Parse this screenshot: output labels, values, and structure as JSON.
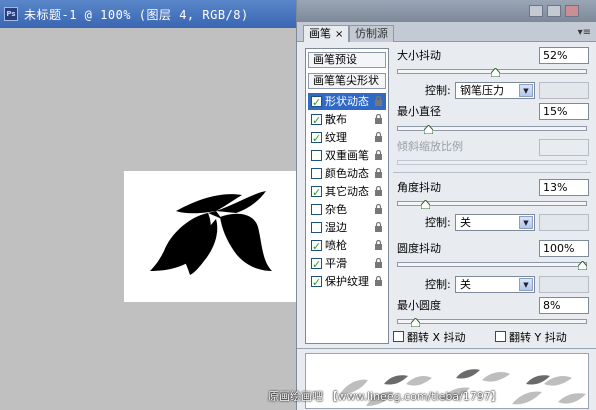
{
  "colors": {
    "accent": "#316ac5",
    "check": "#21a121",
    "titlebar": "#3a66b3"
  },
  "document": {
    "title": "未标题-1 @ 100% (图层 4, RGB/8)",
    "app_icon_label": "Ps"
  },
  "panel": {
    "tabs": [
      {
        "label": "画笔",
        "close": "×"
      },
      {
        "label": "仿制源"
      }
    ],
    "menu_icon": "▾≡"
  },
  "brush_list": {
    "presets_label": "画笔预设",
    "tip_shape_label": "画笔笔尖形状",
    "items": [
      {
        "label": "形状动态",
        "checked": true,
        "selected": true
      },
      {
        "label": "散布",
        "checked": true
      },
      {
        "label": "纹理",
        "checked": true
      },
      {
        "label": "双重画笔",
        "checked": false
      },
      {
        "label": "颜色动态",
        "checked": false
      },
      {
        "label": "其它动态",
        "checked": true
      },
      {
        "label": "杂色",
        "checked": false
      },
      {
        "label": "湿边",
        "checked": false
      },
      {
        "label": "喷枪",
        "checked": true
      },
      {
        "label": "平滑",
        "checked": true
      },
      {
        "label": "保护纹理",
        "checked": true
      }
    ]
  },
  "settings": {
    "size_jitter": {
      "label": "大小抖动",
      "value": "52%",
      "level": 0.52
    },
    "size_control": {
      "label": "控制:",
      "value": "钢笔压力"
    },
    "min_diameter": {
      "label": "最小直径",
      "value": "15%",
      "level": 0.15
    },
    "tilt_scale": {
      "label": "倾斜缩放比例",
      "value": ""
    },
    "angle_jitter": {
      "label": "角度抖动",
      "value": "13%",
      "level": 0.13
    },
    "angle_control": {
      "label": "控制:",
      "value": "关"
    },
    "roundness_jitter": {
      "label": "圆度抖动",
      "value": "100%",
      "level": 1.0
    },
    "roundness_control": {
      "label": "控制:",
      "value": "关"
    },
    "min_roundness": {
      "label": "最小圆度",
      "value": "8%",
      "level": 0.08
    },
    "flip_x": {
      "label": "翻转 X 抖动",
      "checked": false
    },
    "flip_y": {
      "label": "翻转 Y 抖动",
      "checked": false
    }
  },
  "watermark": "原画绘画吧 【www.lineeg.com/tieba/1797】"
}
